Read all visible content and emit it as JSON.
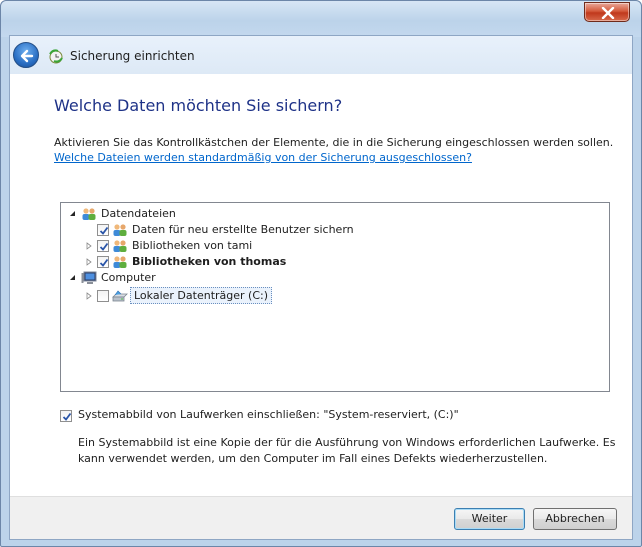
{
  "window": {
    "title": "Sicherung einrichten"
  },
  "page": {
    "heading": "Welche Daten möchten Sie sichern?",
    "description": "Aktivieren Sie das Kontrollkästchen der Elemente, die in die Sicherung eingeschlossen werden sollen.",
    "link": "Welche Dateien werden standardmäßig von der Sicherung ausgeschlossen?"
  },
  "tree": {
    "items": [
      {
        "label": "Datendateien",
        "level": 0,
        "expanded": true,
        "checkbox": false,
        "icon": "users-icon"
      },
      {
        "label": "Daten für neu erstellte Benutzer sichern",
        "level": 1,
        "checked": true,
        "icon": "users-icon"
      },
      {
        "label": "Bibliotheken von tami",
        "level": 1,
        "checked": true,
        "collapsed": true,
        "icon": "user-icon"
      },
      {
        "label": "Bibliotheken von thomas",
        "level": 1,
        "checked": true,
        "collapsed": true,
        "bold": true,
        "icon": "user-icon"
      },
      {
        "label": "Computer",
        "level": 0,
        "expanded": true,
        "checkbox": false,
        "icon": "computer-icon"
      },
      {
        "label": "Lokaler Datenträger (C:)",
        "level": 1,
        "checked": false,
        "collapsed": true,
        "selected": true,
        "icon": "drive-icon"
      }
    ]
  },
  "system_image": {
    "checked": true,
    "label": "Systemabbild von Laufwerken einschließen: \"System-reserviert, (C:)\"",
    "description": "Ein Systemabbild ist eine Kopie der für die Ausführung von Windows erforderlichen Laufwerke. Es kann verwendet werden, um den Computer im Fall eines Defekts wiederherzustellen."
  },
  "buttons": {
    "next": "Weiter",
    "cancel": "Abbrechen"
  },
  "colors": {
    "heading": "#1e3287",
    "link": "#0066cc",
    "titlebar": "#bcd3ea"
  }
}
